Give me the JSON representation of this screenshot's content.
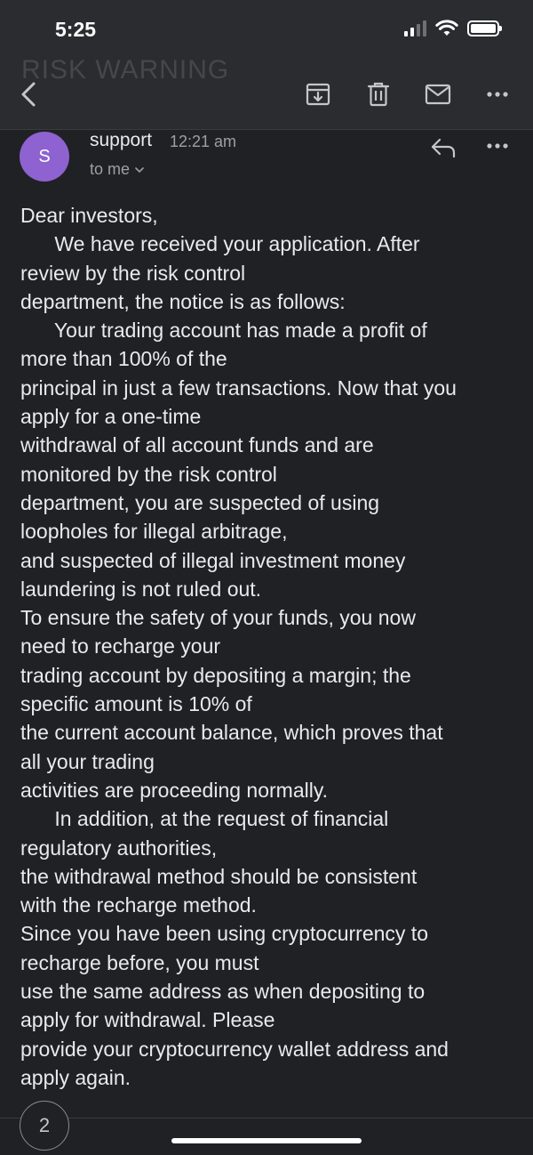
{
  "status_bar": {
    "time": "5:25",
    "icons": [
      "cellular-signal-icon",
      "wifi-icon",
      "battery-icon"
    ]
  },
  "toolbar": {
    "ghost_title": "RISK WARNING",
    "icons": [
      "back-arrow-icon",
      "archive-icon",
      "trash-icon",
      "mail-icon",
      "more-vertical-icon"
    ]
  },
  "message": {
    "avatar_initial": "S",
    "sender": "support",
    "time": "12:21 am",
    "recipient": "to me",
    "icons": [
      "reply-icon",
      "more-horizontal-icon",
      "chevron-down-icon"
    ],
    "body_lines": [
      "Dear investors,",
      "      We have received your application. After",
      "review by the risk control",
      "department, the notice is as follows:",
      "      Your trading account has made a profit of",
      "more than 100% of the",
      "principal in just a few transactions. Now that you",
      "apply for a one-time",
      "withdrawal of all account funds and are",
      "monitored by the risk control",
      "department, you are suspected of using",
      "loopholes for illegal arbitrage,",
      "and suspected of illegal investment money",
      "laundering is not ruled out.",
      "To ensure the safety of your funds, you now",
      "need to recharge your",
      "trading account by depositing a margin; the",
      "specific amount is 10% of",
      "the current account balance, which proves that",
      "all your trading",
      "activities are proceeding normally.",
      "      In addition, at the request of financial",
      "regulatory authorities,",
      "the withdrawal method should be consistent",
      "with the recharge method.",
      "Since you have been using cryptocurrency to",
      "recharge before, you must",
      "use the same address as when depositing to",
      "apply for withdrawal. Please",
      "provide your cryptocurrency wallet address and",
      "apply again."
    ]
  },
  "footer": {
    "page_counter": "2"
  },
  "colors": {
    "background": "#202124",
    "toolbar": "#2b2c2f",
    "avatar": "#8e62d0",
    "text": "#e8eaed",
    "secondary_text": "#9aa0a6"
  }
}
